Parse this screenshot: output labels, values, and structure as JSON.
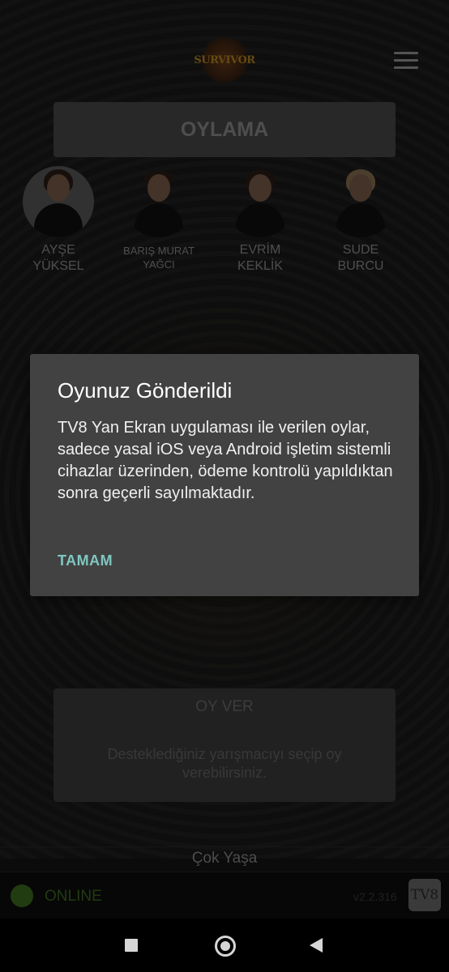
{
  "header": {
    "logo_text": "SURVIVOR",
    "menu_icon": "hamburger-menu-icon"
  },
  "oylama_button": "OYLAMA",
  "contestants": [
    {
      "line1": "AYŞE",
      "line2": "YÜKSEL",
      "selected": true
    },
    {
      "line1": "BARIŞ MURAT",
      "line2": "YAĞCI",
      "selected": false
    },
    {
      "line1": "EVRİM",
      "line2": "KEKLİK",
      "selected": false
    },
    {
      "line1": "SUDE",
      "line2": "BURCU",
      "selected": false
    }
  ],
  "dialog": {
    "title": "Oyunuz Gönderildi",
    "body": "TV8 Yan Ekran uygulaması ile verilen oylar, sadece yasal iOS veya Android işletim sistemli cihazlar üzerinden, ödeme kontrolü yapıldıktan sonra geçerli sayılmaktadır.",
    "ok_label": "TAMAM"
  },
  "vote_box": {
    "title": "OY VER",
    "description": "Desteklediğiniz yarışmacıyı seçip oy verebilirsiniz."
  },
  "footer": {
    "slogan": "Çok Yaşa",
    "status": "ONLINE",
    "version": "v2.2.316",
    "badge": "TV8"
  },
  "colors": {
    "online_green": "#3f6d22",
    "dialog_accent": "#7fc7c1",
    "dialog_bg": "#424242"
  }
}
